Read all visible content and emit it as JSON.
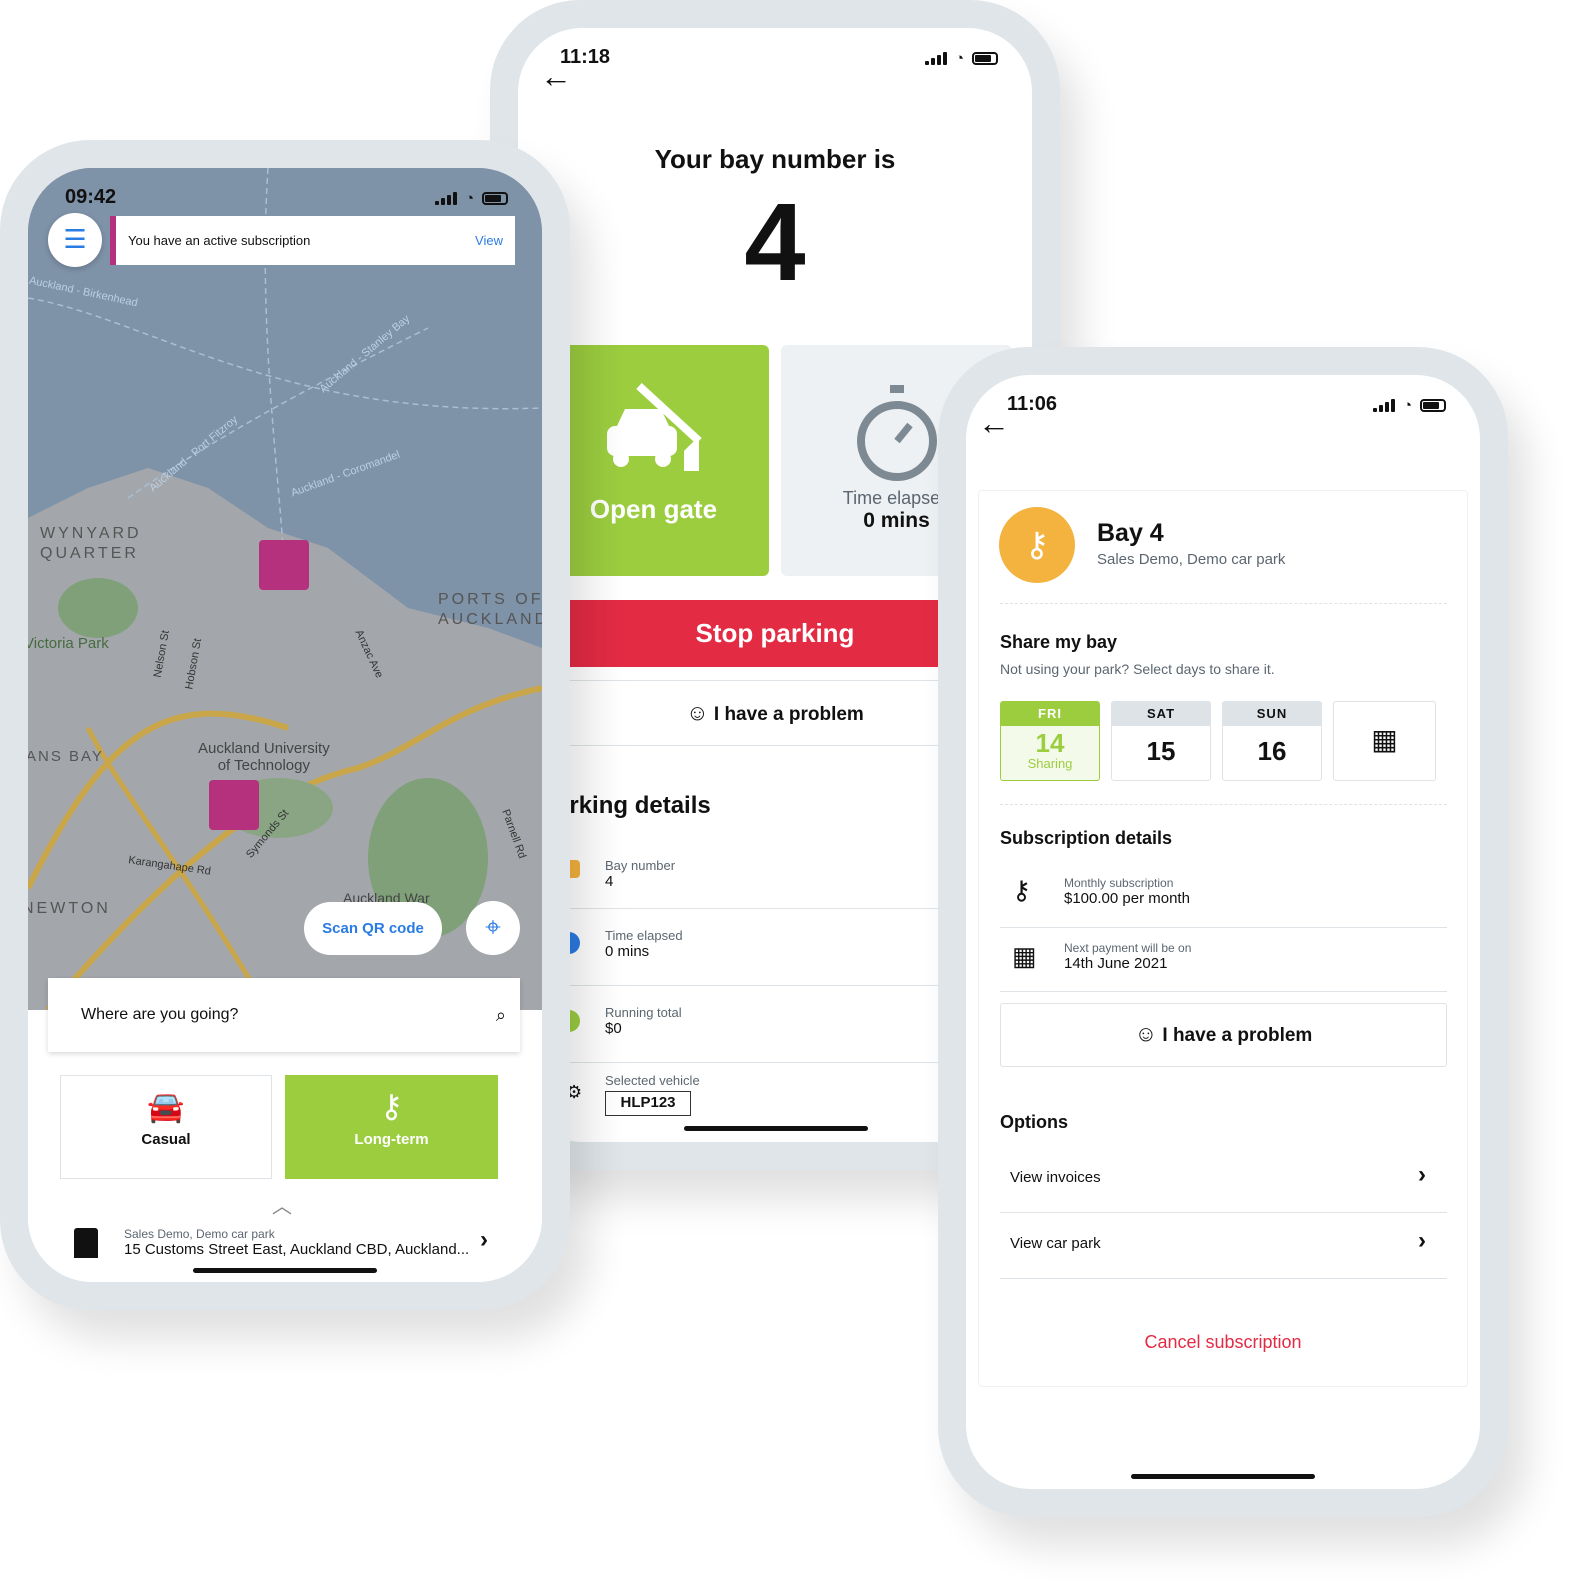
{
  "colors": {
    "green": "#9bcd3f",
    "red": "#e32b44",
    "orange": "#f4b23e",
    "pink": "#b5307d",
    "blue": "#2b7be4",
    "frame": "#dfe5e8"
  },
  "map_phone": {
    "time": "09:42",
    "banner": {
      "text": "You have an active subscription",
      "link": "View"
    },
    "map_labels": [
      "WYNYARD",
      "QUARTER",
      "PORTS OF",
      "AUCKLAND",
      "Victoria Park",
      "Auckland University",
      "of Technology",
      "Karangahape Rd",
      "NEWTON",
      "ANS BAY",
      "Auckland - Birkenhead",
      "Auckland - Stanley Bay",
      "Auckland - Port Fitzroy",
      "Auckland - Coromandel",
      "Nelson St",
      "Hobson St",
      "Anzac Ave",
      "Symonds St",
      "Parnell Rd",
      "Auckland War"
    ],
    "scan_qr": "Scan QR code",
    "search_placeholder": "Where are you going?",
    "modes": [
      {
        "label": "Casual",
        "icon": "car-icon"
      },
      {
        "label": "Long-term",
        "icon": "key-icon",
        "active": true
      }
    ],
    "car_park": {
      "name": "Sales Demo, Demo car park",
      "address": "15 Customs Street East, Auckland CBD, Auckland..."
    }
  },
  "parking_phone": {
    "time": "11:18",
    "title": "Your bay number is",
    "bay_number": "4",
    "open_gate": "Open gate",
    "time_tile": {
      "label": "Time elapsed",
      "value": "0 mins"
    },
    "stop": "Stop parking",
    "problem": "I have a problem",
    "details_title": "Parking details",
    "details": [
      {
        "label": "Bay number",
        "value": "4",
        "icon": "bay-icon"
      },
      {
        "label": "Time elapsed",
        "value": "0 mins",
        "icon": "clock-icon"
      },
      {
        "label": "Running total",
        "value": "$0",
        "icon": "dollar-icon"
      },
      {
        "label": "Selected vehicle",
        "value": "HLP123",
        "icon": "vehicle-icon"
      }
    ]
  },
  "subscription_phone": {
    "time": "11:06",
    "bay": "Bay 4",
    "car_park": "Sales Demo, Demo car park",
    "share_title": "Share my bay",
    "share_sub": "Not using your park? Select days to share it.",
    "days": [
      {
        "day": "FRI",
        "date": "14",
        "status": "Sharing"
      },
      {
        "day": "SAT",
        "date": "15"
      },
      {
        "day": "SUN",
        "date": "16"
      }
    ],
    "sub_title": "Subscription details",
    "sub_rows": [
      {
        "label": "Monthly subscription",
        "value": "$100.00 per month"
      },
      {
        "label": "Next payment will be on",
        "value": "14th June 2021"
      }
    ],
    "problem": "I have a problem",
    "options_title": "Options",
    "options": [
      "View invoices",
      "View car park"
    ],
    "cancel": "Cancel subscription"
  }
}
